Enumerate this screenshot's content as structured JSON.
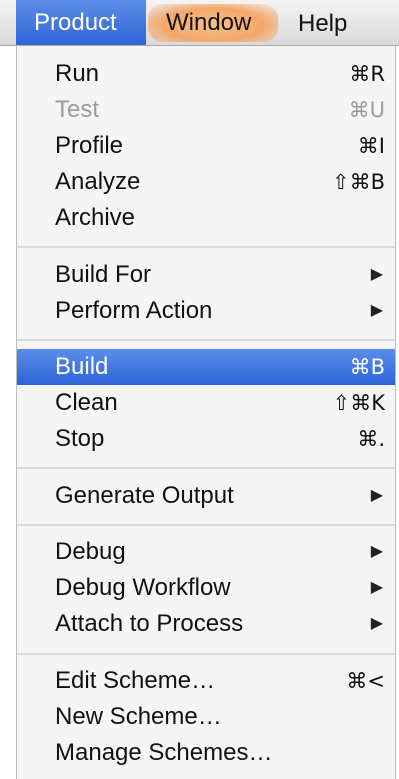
{
  "menubar": {
    "product": "Product",
    "window": "Window",
    "help": "Help"
  },
  "menu": {
    "run": {
      "label": "Run",
      "shortcut": "⌘R"
    },
    "test": {
      "label": "Test",
      "shortcut": "⌘U"
    },
    "profile": {
      "label": "Profile",
      "shortcut": "⌘I"
    },
    "analyze": {
      "label": "Analyze",
      "shortcut": "⇧⌘B"
    },
    "archive": {
      "label": "Archive"
    },
    "build_for": {
      "label": "Build For",
      "arrow": "▶"
    },
    "perform_action": {
      "label": "Perform Action",
      "arrow": "▶"
    },
    "build": {
      "label": "Build",
      "shortcut": "⌘B"
    },
    "clean": {
      "label": "Clean",
      "shortcut": "⇧⌘K"
    },
    "stop": {
      "label": "Stop",
      "shortcut": "⌘."
    },
    "generate_output": {
      "label": "Generate Output",
      "arrow": "▶"
    },
    "debug": {
      "label": "Debug",
      "arrow": "▶"
    },
    "debug_workflow": {
      "label": "Debug Workflow",
      "arrow": "▶"
    },
    "attach_to_process": {
      "label": "Attach to Process",
      "arrow": "▶"
    },
    "edit_scheme": {
      "label": "Edit Scheme…",
      "shortcut": "⌘<"
    },
    "new_scheme": {
      "label": "New Scheme…"
    },
    "manage_schemes": {
      "label": "Manage Schemes…"
    }
  },
  "colors": {
    "highlight": "#2d62d8",
    "disabled_text": "#9a9a9a"
  }
}
